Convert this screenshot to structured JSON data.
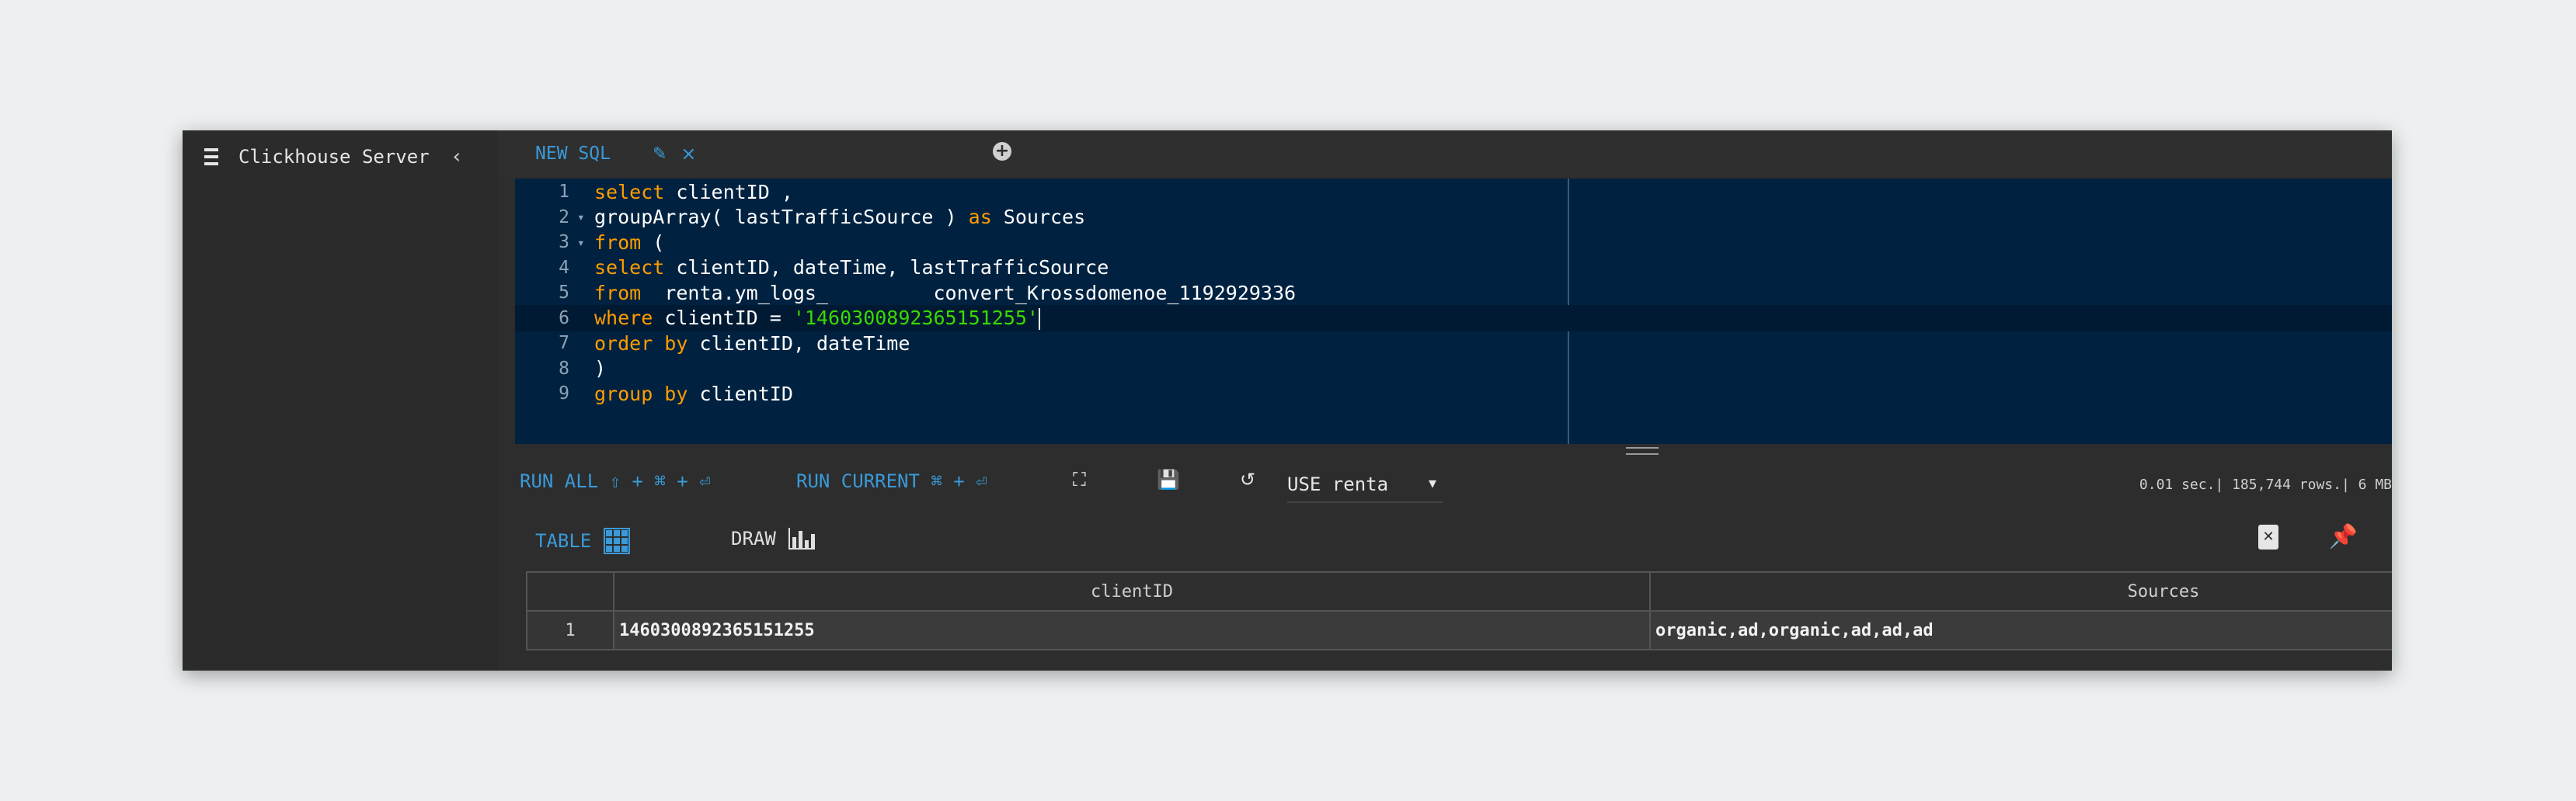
{
  "sidebar": {
    "title": "Clickhouse Server",
    "collapse_icon": "chevron-left-icon",
    "menu_icon": "hamburger-menu-icon"
  },
  "tabs": [
    {
      "label": "NEW SQL",
      "edit_icon": "pencil-icon",
      "close_icon": "close-icon"
    }
  ],
  "add_tab_icon": "plus-circle-icon",
  "editor": {
    "lines": [
      {
        "num": "1",
        "fold": "",
        "text": "select clientID ,"
      },
      {
        "num": "2",
        "fold": "▾",
        "text": "groupArray( lastTrafficSource ) as Sources"
      },
      {
        "num": "3",
        "fold": "▾",
        "text": "from ("
      },
      {
        "num": "4",
        "fold": "",
        "text": "select clientID, dateTime, lastTrafficSource"
      },
      {
        "num": "5",
        "fold": "",
        "text": "from  renta.ym_logs_         convert_Krossdomenoe_1192929336"
      },
      {
        "num": "6",
        "fold": "",
        "text": "where clientID = '1460300892365151255'"
      },
      {
        "num": "7",
        "fold": "",
        "text": "order by clientID, dateTime"
      },
      {
        "num": "8",
        "fold": "",
        "text": ")"
      },
      {
        "num": "9",
        "fold": "",
        "text": "group by clientID"
      }
    ],
    "active_line": 6
  },
  "toolbar": {
    "run_all": "RUN ALL ⇧ + ⌘ + ⏎",
    "run_current": "RUN CURRENT ⌘ + ⏎",
    "fullscreen_icon": "expand-icon",
    "save_icon": "save-icon",
    "history_icon": "history-icon",
    "use_db": "USE renta",
    "stats": "0.01 sec.| 185,744 rows.| 6 MB"
  },
  "result_tabs": {
    "table_label": "TABLE",
    "draw_label": "DRAW"
  },
  "table": {
    "columns": [
      "",
      "clientID",
      "Sources"
    ],
    "rows": [
      [
        "1",
        "1460300892365151255",
        "organic,ad,organic,ad,ad,ad"
      ]
    ]
  },
  "colors": {
    "accent": "#3a9ad9",
    "editor_bg": "#002240",
    "keyword": "#ff9d00",
    "string": "#3ad900"
  }
}
